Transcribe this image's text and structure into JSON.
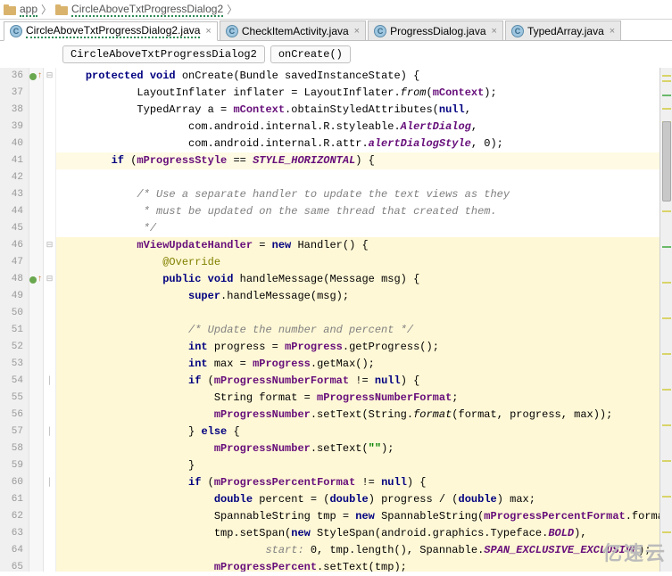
{
  "nav": {
    "seg1_icon": "folder",
    "seg1": "app",
    "seg2_icon": "folder",
    "seg2": "CircleAboveTxtProgressDialog2"
  },
  "tabs": [
    {
      "icon": "C",
      "label": "CircleAboveTxtProgressDialog2.java",
      "active": true,
      "wavy": true
    },
    {
      "icon": "C",
      "label": "CheckItemActivity.java",
      "active": false,
      "wavy": false
    },
    {
      "icon": "C",
      "label": "ProgressDialog.java",
      "active": false,
      "wavy": false
    },
    {
      "icon": "C",
      "label": "TypedArray.java",
      "active": false,
      "wavy": false
    }
  ],
  "crumbs": {
    "c1": "CircleAboveTxtProgressDialog2",
    "c2": "onCreate()"
  },
  "gutter_start": 36,
  "gutter_count": 30,
  "code": {
    "l36": {
      "kw1": "protected void",
      "fn": " onCreate(Bundle savedInstanceState) {"
    },
    "l37": {
      "p1": "            LayoutInflater inflater = LayoutInflater.",
      "sm": "from",
      "p2": "(",
      "fld": "mContext",
      "p3": ");"
    },
    "l38": {
      "p1": "            TypedArray a = ",
      "fld": "mContext",
      "p2": ".obtainStyledAttributes(",
      "kw": "null",
      "p3": ","
    },
    "l39": {
      "p1": "                    com.android.internal.R.styleable.",
      "sfld": "AlertDialog",
      "p2": ","
    },
    "l40": {
      "p1": "                    com.android.internal.R.attr.",
      "sfld": "alertDialogStyle",
      "p2": ", 0);"
    },
    "l41": {
      "p1": "        ",
      "kw": "if",
      "p2": " (",
      "fld": "mProgressStyle",
      "p3": " == ",
      "sfld": "STYLE_HORIZONTAL",
      "p4": ") {"
    },
    "l42": "",
    "l43": "            /* Use a separate handler to update the text views as they",
    "l44": "             * must be updated on the same thread that created them.",
    "l45": "             */",
    "l46": {
      "p1": "            ",
      "fld": "mViewUpdateHandler",
      "p2": " = ",
      "kw": "new",
      "p3": " Handler() {"
    },
    "l47": {
      "p1": "                ",
      "ann": "@Override"
    },
    "l48": {
      "p1": "                ",
      "kw": "public void",
      "p2": " handleMessage(Message msg) {"
    },
    "l49": {
      "p1": "                    ",
      "kw": "super",
      "p2": ".handleMessage(msg);"
    },
    "l50": "",
    "l51": "                    /* Update the number and percent */",
    "l52": {
      "p1": "                    ",
      "kw": "int",
      "p2": " progress = ",
      "fld": "mProgress",
      "p3": ".getProgress();"
    },
    "l53": {
      "p1": "                    ",
      "kw": "int",
      "p2": " max = ",
      "fld": "mProgress",
      "p3": ".getMax();"
    },
    "l54": {
      "p1": "                    ",
      "kw": "if",
      "p2": " (",
      "fld": "mProgressNumberFormat",
      "p3": " != ",
      "kw2": "null",
      "p4": ") {"
    },
    "l55": {
      "p1": "                        String format = ",
      "fld": "mProgressNumberFormat",
      "p2": ";"
    },
    "l56": {
      "p1": "                        ",
      "fld": "mProgressNumber",
      "p2": ".setText(String.",
      "sm": "format",
      "p3": "(format, progress, max));"
    },
    "l57": {
      "p1": "                    } ",
      "kw": "else",
      "p2": " {"
    },
    "l58": {
      "p1": "                        ",
      "fld": "mProgressNumber",
      "p2": ".setText(",
      "str": "\"\"",
      "p3": ");"
    },
    "l59": "                    }",
    "l60": {
      "p1": "                    ",
      "kw": "if",
      "p2": " (",
      "fld": "mProgressPercentFormat",
      "p3": " != ",
      "kw2": "null",
      "p4": ") {"
    },
    "l61": {
      "p1": "                        ",
      "kw": "double",
      "p2": " percent = (",
      "kw2": "double",
      "p3": ") progress / (",
      "kw3": "double",
      "p4": ") max;"
    },
    "l62": {
      "p1": "                        SpannableString tmp = ",
      "kw": "new",
      "p2": " SpannableString(",
      "fld": "mProgressPercentFormat",
      "p3": ".format(percent));"
    },
    "l63": {
      "p1": "                        tmp.setSpan(",
      "kw": "new",
      "p2": " StyleSpan(android.graphics.Typeface.",
      "sfld": "BOLD",
      "p3": "),"
    },
    "l64": {
      "p1": "                                ",
      "param": "start:",
      "p2": " 0, tmp.length(), Spannable.",
      "sfld": "SPAN_EXCLUSIVE_EXCLUSIVE",
      "p3": ");"
    },
    "l65": {
      "p1": "                        ",
      "fld": "mProgressPercent",
      "p2": ".setText(tmp);"
    }
  },
  "watermark": "亿速云"
}
